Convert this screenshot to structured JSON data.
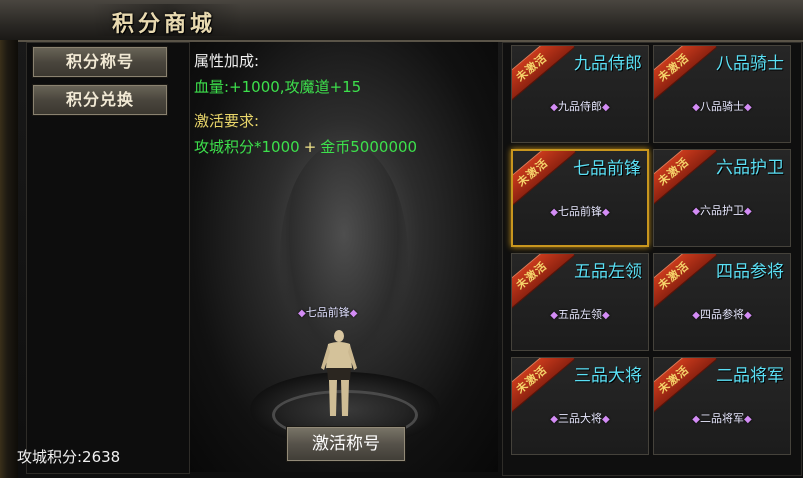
{
  "window": {
    "title": "积分商城"
  },
  "sidebar": {
    "items": [
      {
        "label": "积分称号"
      },
      {
        "label": "积分兑换"
      }
    ]
  },
  "detail": {
    "attr_title": "属性加成:",
    "attr_value": "血量:+1000,攻魔道+15",
    "req_title": "激活要求:",
    "req_part1": "攻城积分*1000",
    "req_plus": "+",
    "req_part2": "金币5000000",
    "preview_badge": "七品前锋",
    "activate_label": "激活称号"
  },
  "footer": {
    "score_label": "攻城积分:2638"
  },
  "cards": [
    {
      "title": "九品侍郎",
      "badge": "九品侍郎",
      "ribbon": "未激活"
    },
    {
      "title": "八品骑士",
      "badge": "八品骑士",
      "ribbon": "未激活"
    },
    {
      "title": "七品前锋",
      "badge": "七品前锋",
      "ribbon": "未激活",
      "selected": true
    },
    {
      "title": "六品护卫",
      "badge": "六品护卫",
      "ribbon": "未激活"
    },
    {
      "title": "五品左领",
      "badge": "五品左领",
      "ribbon": "未激活"
    },
    {
      "title": "四品参将",
      "badge": "四品参将",
      "ribbon": "未激活"
    },
    {
      "title": "三品大将",
      "badge": "三品大将",
      "ribbon": "未激活"
    },
    {
      "title": "二品将军",
      "badge": "二品将军",
      "ribbon": "未激活"
    }
  ],
  "colors": {
    "card_title": "#5be0f5",
    "green_text": "#3de04c",
    "requirement_title": "#e9d66a",
    "selected_border": "#c8961e",
    "ribbon": "#c93a1c"
  }
}
